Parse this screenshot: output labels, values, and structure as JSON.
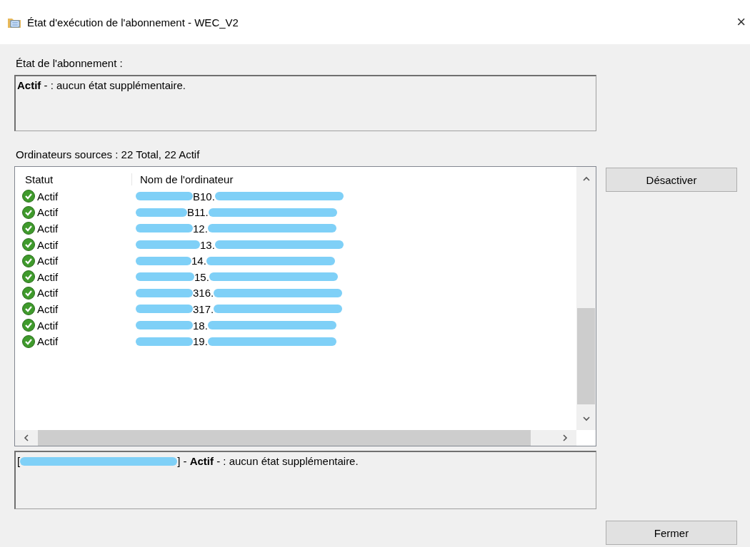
{
  "window": {
    "title": "État d'exécution de l'abonnement - WEC_V2",
    "close": "×"
  },
  "subscription_state": {
    "label": "État de l'abonnement :",
    "value": "**Actif** - : aucun état supplémentaire."
  },
  "sources_label": "Ordinateurs sources : 22 Total, 22 Actif",
  "table": {
    "columns": [
      "Statut",
      "Nom de l'ordinateur"
    ],
    "rows": [
      {
        "status": "Actif",
        "name": "B10."
      },
      {
        "status": "Actif",
        "name": "B11."
      },
      {
        "status": "Actif",
        "name": "12."
      },
      {
        "status": "Actif",
        "name": "13."
      },
      {
        "status": "Actif",
        "name": "14."
      },
      {
        "status": "Actif",
        "name": "15."
      },
      {
        "status": "Actif",
        "name": "316."
      },
      {
        "status": "Actif",
        "name": "317."
      },
      {
        "status": "Actif",
        "name": "18."
      },
      {
        "status": "Actif",
        "name": "19."
      }
    ]
  },
  "detail": {
    "prefix": "[",
    "text": "] - **Actif** - : aucun état supplémentaire."
  },
  "buttons": {
    "deactivate": "Désactiver",
    "close": "Fermer"
  }
}
